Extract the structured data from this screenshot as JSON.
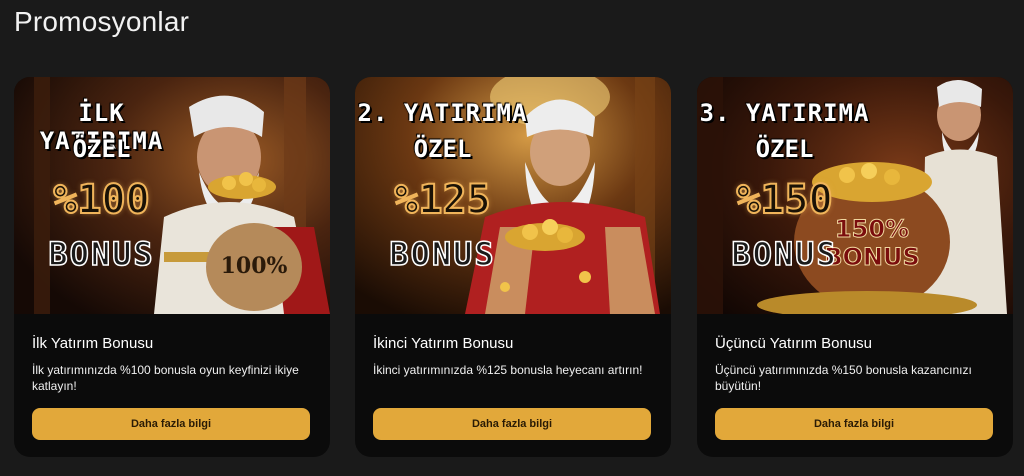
{
  "page": {
    "title": "Promosyonlar"
  },
  "colors": {
    "accent": "#e2a83a",
    "card_bg": "#0b0b0b",
    "page_bg": "#1a1a1a"
  },
  "cards": [
    {
      "banner": {
        "line1": "İLK YATIRIMA",
        "line2": "ÖZEL",
        "percent": "%100",
        "bonus": "BONUS",
        "sack_text": "100%"
      },
      "title": "İlk Yatırım Bonusu",
      "description": "İlk yatırımınızda %100 bonusla oyun keyfinizi ikiye katlayın!",
      "button_label": "Daha fazla bilgi"
    },
    {
      "banner": {
        "line1": "2. YATIRIMA",
        "line2": "ÖZEL",
        "percent": "%125",
        "bonus": "BONUS",
        "sack_text": ""
      },
      "title": "İkinci Yatırım Bonusu",
      "description": "İkinci yatırımınızda %125 bonusla heyecanı artırın!",
      "button_label": "Daha fazla bilgi"
    },
    {
      "banner": {
        "line1": "3. YATIRIMA",
        "line2": "ÖZEL",
        "percent": "%150",
        "bonus": "BONUS",
        "sack_text": "150% BONUS"
      },
      "title": "Üçüncü Yatırım Bonusu",
      "description": "Üçüncü yatırımınızda %150 bonusla kazancınızı büyütün!",
      "button_label": "Daha fazla bilgi"
    }
  ]
}
